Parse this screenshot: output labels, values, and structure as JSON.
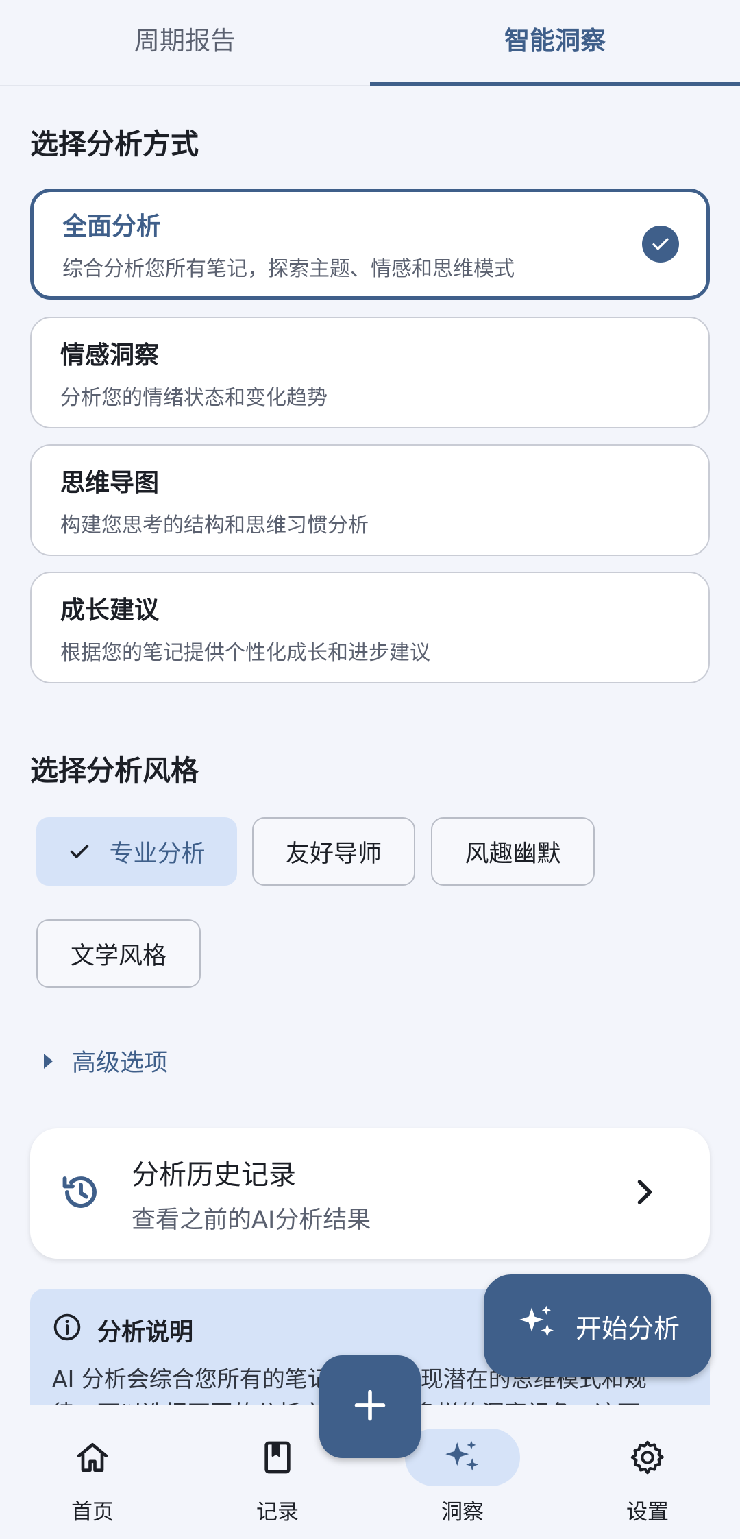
{
  "tabs": [
    {
      "label": "周期报告",
      "active": false
    },
    {
      "label": "智能洞察",
      "active": true
    }
  ],
  "method_section": {
    "title": "选择分析方式",
    "options": [
      {
        "title": "全面分析",
        "desc": "综合分析您所有笔记，探索主题、情感和思维模式",
        "selected": true
      },
      {
        "title": "情感洞察",
        "desc": "分析您的情绪状态和变化趋势",
        "selected": false
      },
      {
        "title": "思维导图",
        "desc": "构建您思考的结构和思维习惯分析",
        "selected": false
      },
      {
        "title": "成长建议",
        "desc": "根据您的笔记提供个性化成长和进步建议",
        "selected": false
      }
    ]
  },
  "style_section": {
    "title": "选择分析风格",
    "chips": [
      {
        "label": "专业分析",
        "selected": true
      },
      {
        "label": "友好导师",
        "selected": false
      },
      {
        "label": "风趣幽默",
        "selected": false
      },
      {
        "label": "文学风格",
        "selected": false
      }
    ]
  },
  "advanced_label": "高级选项",
  "history": {
    "title": "分析历史记录",
    "subtitle": "查看之前的AI分析结果"
  },
  "info": {
    "title": "分析说明",
    "body": "AI 分析会综合您所有的笔记内容，发现潜在的思维模式和规律，可以选择不同的分析方式，获取多样的洞察视角，这可"
  },
  "start_button_label": "开始分析",
  "bottom_nav": [
    {
      "label": "首页",
      "icon": "home-icon",
      "active": false
    },
    {
      "label": "记录",
      "icon": "notebook-icon",
      "active": false
    },
    {
      "label": "洞察",
      "icon": "sparkle-icon",
      "active": true
    },
    {
      "label": "设置",
      "icon": "gear-icon",
      "active": false
    }
  ],
  "colors": {
    "primary": "#3f5f8a",
    "selected_bg": "#d6e3f8",
    "background": "#f3f5fb"
  }
}
